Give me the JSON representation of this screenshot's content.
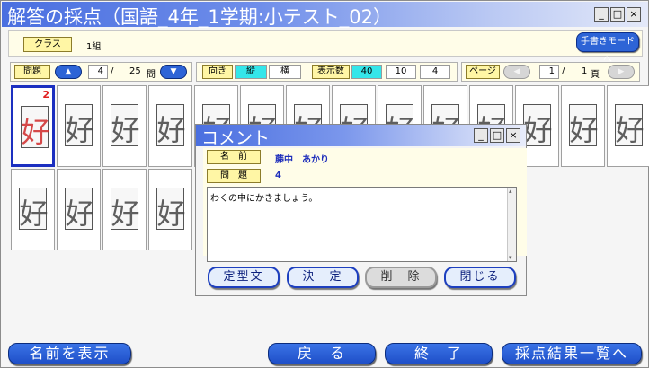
{
  "window": {
    "title": "解答の採点（国語_4年_1学期:小テスト_02）",
    "min": "_",
    "max": "□",
    "close": "×"
  },
  "top": {
    "class_label": "クラス",
    "class_value": "1組",
    "handwrite_button": "手書きモードへ"
  },
  "question_nav": {
    "label": "問題",
    "up_icon": "▲",
    "current": "4",
    "sep": "/",
    "total": "25",
    "unit": "問",
    "down_icon": "▼"
  },
  "orientation": {
    "label": "向き",
    "vertical": "縦",
    "horizontal": "横",
    "selected": "縦"
  },
  "display_count": {
    "label": "表示数",
    "options": [
      "40",
      "10",
      "4"
    ],
    "selected": "40"
  },
  "page_nav": {
    "label": "ページ",
    "prev_icon": "◀",
    "current": "1",
    "sep": "/",
    "total": "1",
    "unit": "頁",
    "next_icon": "▶"
  },
  "answers": {
    "kanji": "好",
    "selected_mark": "2"
  },
  "dialog": {
    "title": "コメント",
    "name_label": "名　前",
    "name_value": "藤中　あかり",
    "question_label": "問　題",
    "question_value": "4",
    "comment": "わくの中にかきましょう。",
    "buttons": [
      "定型文",
      "決　定",
      "削　除",
      "閉じる"
    ]
  },
  "bottom": {
    "show_names": "名前を表示",
    "back": "戻　る",
    "exit": "終　了",
    "results_list": "採点結果一覧へ"
  }
}
